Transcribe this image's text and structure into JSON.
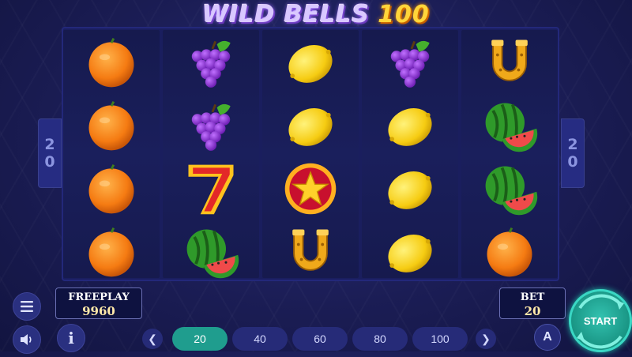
{
  "logo": {
    "part1": "WILD BELLS",
    "part2": "100"
  },
  "paylines": {
    "left": [
      "2",
      "0"
    ],
    "right": [
      "2",
      "0"
    ]
  },
  "reels": [
    [
      "orange-icon",
      "orange-icon",
      "orange-icon",
      "orange-icon"
    ],
    [
      "grapes-icon",
      "grapes-icon",
      "seven-icon",
      "watermelon-icon"
    ],
    [
      "lemon-icon",
      "lemon-icon",
      "star-icon",
      "horseshoe-icon"
    ],
    [
      "grapes-icon",
      "lemon-icon",
      "lemon-icon",
      "lemon-icon"
    ],
    [
      "horseshoe-icon",
      "watermelon-icon",
      "watermelon-icon",
      "orange-icon"
    ]
  ],
  "freeplay": {
    "label": "FREEPLAY",
    "value": "9960"
  },
  "bet": {
    "label": "BET",
    "value": "20"
  },
  "bet_options": [
    "20",
    "40",
    "60",
    "80",
    "100"
  ],
  "selected_bet": "20",
  "start_label": "START",
  "auto_label": "A",
  "info_label": "i",
  "colors": {
    "accent": "#1f9d8e",
    "background": "#1b1d55",
    "reel": "#1a1f5c"
  }
}
